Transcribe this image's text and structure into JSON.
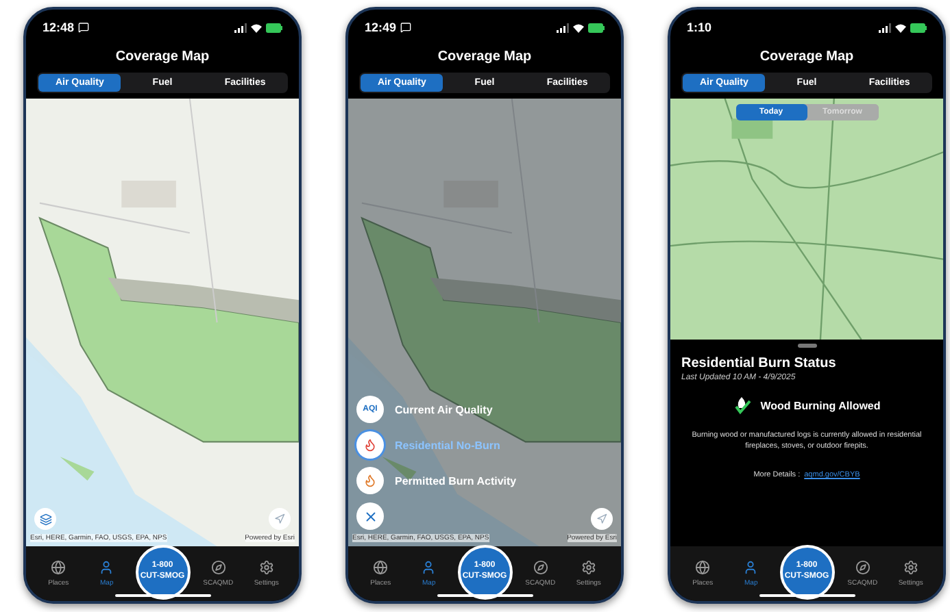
{
  "phones": [
    {
      "kind": "map",
      "time": "12:48",
      "title": "Coverage Map",
      "tabs": [
        {
          "label": "Air Quality",
          "selected": true
        },
        {
          "label": "Fuel",
          "selected": false
        },
        {
          "label": "Facilities",
          "selected": false
        }
      ],
      "attribution": "Esri, HERE, Garmin, FAO, USGS, EPA, NPS",
      "powered_by": "Powered by Esri",
      "nav": [
        {
          "label": "Places",
          "selected": false
        },
        {
          "label": "Map",
          "selected": true
        },
        {
          "label": "SCAQMD",
          "selected": false
        },
        {
          "label": "Settings",
          "selected": false
        }
      ],
      "call": [
        "1-800",
        "CUT-SMOG"
      ]
    },
    {
      "kind": "menu",
      "time": "12:49",
      "title": "Coverage Map",
      "tabs": [
        {
          "label": "Air Quality",
          "selected": true
        },
        {
          "label": "Fuel",
          "selected": false
        },
        {
          "label": "Facilities",
          "selected": false
        }
      ],
      "attribution": "Esri, HERE, Garmin, FAO, USGS, EPA, NPS",
      "powered_by": "Powered by Esri",
      "menu": [
        {
          "badge": "AQI",
          "label": "Current Air Quality",
          "selected": false
        },
        {
          "label": "Residential No-Burn",
          "selected": true
        },
        {
          "label": "Permitted Burn Activity",
          "selected": false
        }
      ],
      "nav": [
        {
          "label": "Places",
          "selected": false
        },
        {
          "label": "Map",
          "selected": true
        },
        {
          "label": "SCAQMD",
          "selected": false
        },
        {
          "label": "Settings",
          "selected": false
        }
      ],
      "call": [
        "1-800",
        "CUT-SMOG"
      ]
    },
    {
      "kind": "status",
      "time": "1:10",
      "title": "Coverage Map",
      "tabs": [
        {
          "label": "Air Quality",
          "selected": true
        },
        {
          "label": "Fuel",
          "selected": false
        },
        {
          "label": "Facilities",
          "selected": false
        }
      ],
      "days": [
        {
          "label": "Today",
          "selected": true
        },
        {
          "label": "Tomorrow",
          "selected": false
        }
      ],
      "sheet": {
        "title": "Residential Burn Status",
        "updated": "Last Updated  10 AM - 4/9/2025",
        "status": "Wood Burning Allowed",
        "description": "Burning wood or manufactured logs is currently allowed in residential fireplaces, stoves, or outdoor firepits.",
        "details_label": "More Details :",
        "details_link": "aqmd.gov/CBYB"
      },
      "nav": [
        {
          "label": "Places",
          "selected": false
        },
        {
          "label": "Map",
          "selected": true
        },
        {
          "label": "SCAQMD",
          "selected": false
        },
        {
          "label": "Settings",
          "selected": false
        }
      ],
      "call": [
        "1-800",
        "CUT-SMOG"
      ]
    }
  ]
}
